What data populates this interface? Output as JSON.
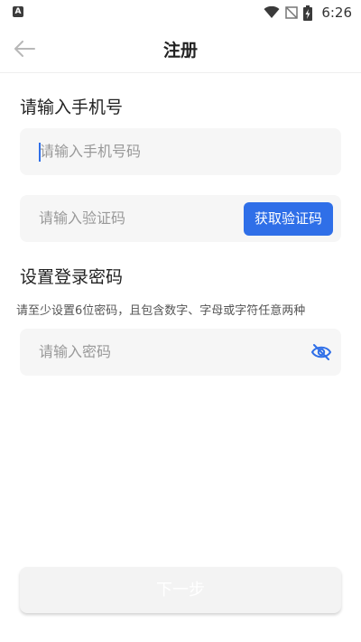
{
  "status_bar": {
    "left_icon": "A",
    "time": "6:26",
    "icons": [
      "wifi-icon",
      "signal-off-icon",
      "battery-charging-icon"
    ]
  },
  "header": {
    "back_icon": "arrow-left-icon",
    "title": "注册"
  },
  "phone_section": {
    "title": "请输入手机号",
    "phone_placeholder": "请输入手机号码",
    "code_placeholder": "请输入验证码",
    "get_code_label": "获取验证码"
  },
  "password_section": {
    "title": "设置登录密码",
    "hint": "请至少设置6位密码，且包含数字、字母或字符任意两种",
    "password_placeholder": "请输入密码",
    "toggle_icon": "eye-off-icon"
  },
  "next_button": {
    "label": "下一步"
  },
  "colors": {
    "accent": "#2f6fe8",
    "field_bg": "#f6f6f6",
    "placeholder": "#999999"
  }
}
